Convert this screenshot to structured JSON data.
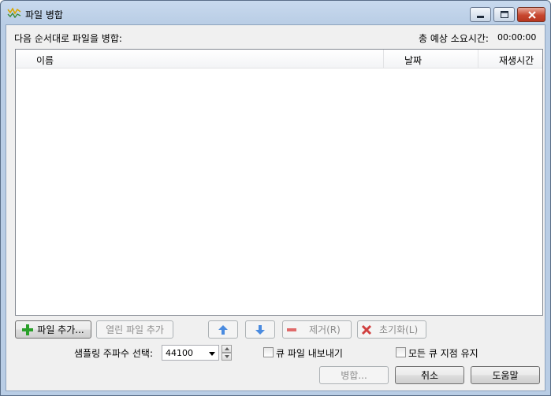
{
  "window": {
    "title": "파일 병합"
  },
  "header": {
    "order_label": "다음 순서대로 파일을 병합:",
    "total_time_label": "총 예상 소요시간:",
    "total_time_value": "00:00:00"
  },
  "list": {
    "columns": [
      "이름",
      "날짜",
      "재생시간"
    ],
    "rows": []
  },
  "toolbar": {
    "add_file": "파일 추가...",
    "add_open_file": "열린 파일 추가",
    "remove": "제거(R)",
    "reset": "초기화(L)"
  },
  "options": {
    "sample_rate_label": "샘플링 주파수 선택:",
    "sample_rate_value": "44100",
    "export_queue_label": "큐 파일 내보내기",
    "keep_queue_points_label": "모든 큐 지점 유지"
  },
  "footer": {
    "merge": "병합...",
    "cancel": "취소",
    "help": "도움말"
  },
  "colors": {
    "up_down_arrow": "#4a8be0",
    "add_plus": "#2aa02a",
    "remove_minus": "#e06a6a",
    "reset_x": "#d04040"
  }
}
